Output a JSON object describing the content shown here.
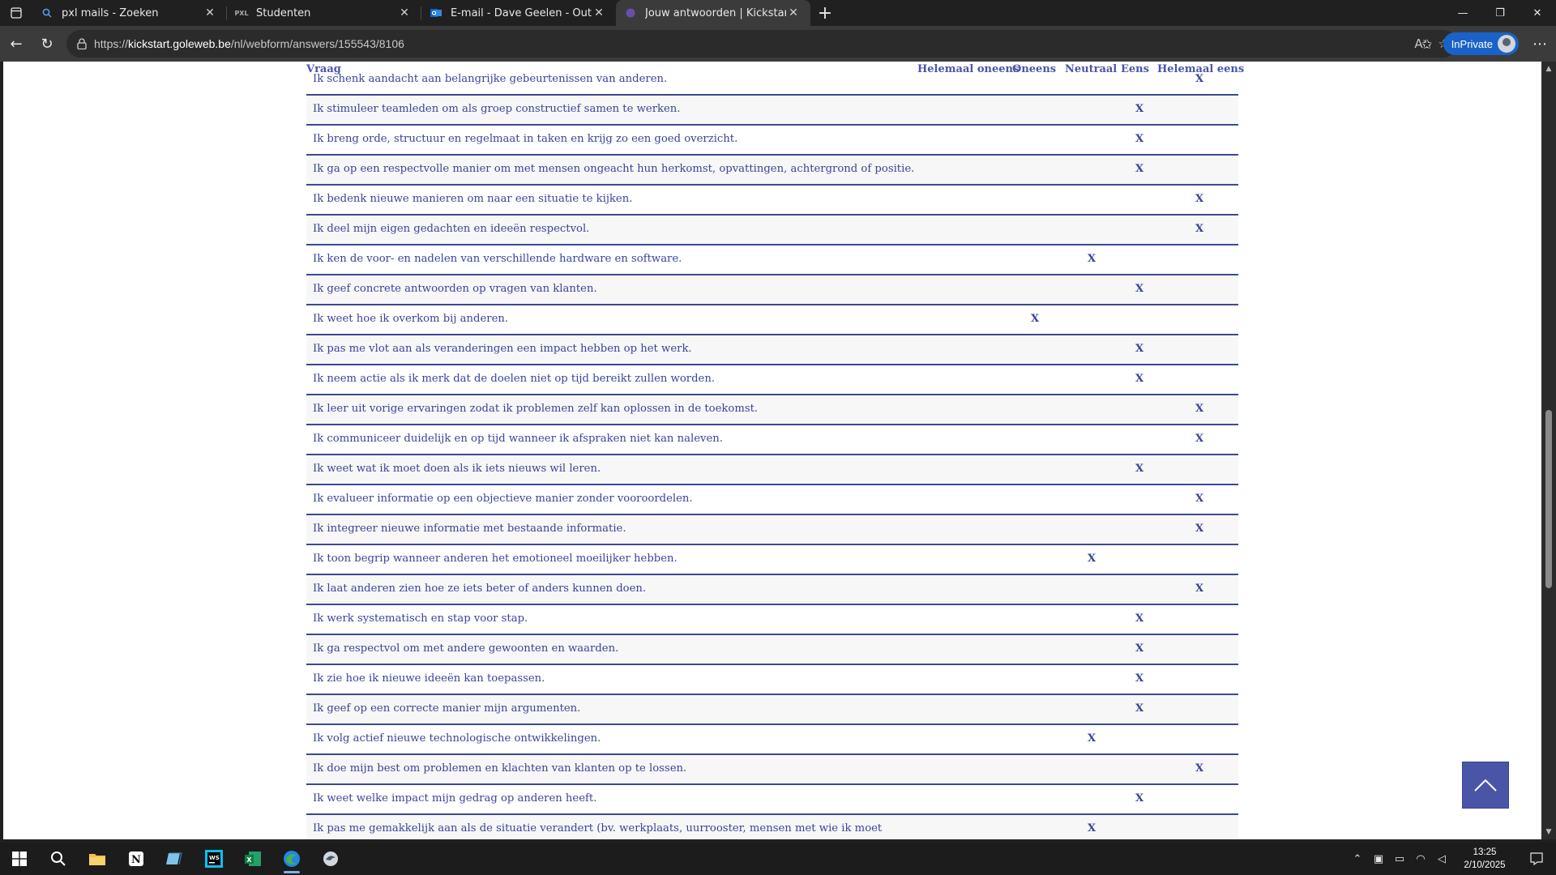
{
  "browser": {
    "tabs": [
      {
        "title": "pxl mails - Zoeken",
        "icon": "search-icon"
      },
      {
        "title": "Studenten",
        "icon": "pxl-icon"
      },
      {
        "title": "E-mail - Dave Geelen - Outlook",
        "icon": "outlook-icon"
      },
      {
        "title": "Jouw antwoorden | Kickstart - Len",
        "icon": "kickstart-icon"
      }
    ],
    "url_prefix": "https://",
    "url_host": "kickstart.goleweb.be",
    "url_path": "/nl/webform/answers/155543/8106",
    "inprivate_label": "InPrivate"
  },
  "table": {
    "headers": {
      "vraag": "Vraag",
      "helemaal_oneens": "Helemaal oneens",
      "oneens": "Oneens",
      "neutraal": "Neutraal",
      "eens": "Eens",
      "helemaal_eens": "Helemaal eens"
    },
    "mark_symbol": "X",
    "rows": [
      {
        "q": "Ik schenk aandacht aan belangrijke gebeurtenissen van anderen.",
        "answer": "helemaal_eens"
      },
      {
        "q": "Ik stimuleer teamleden om als groep constructief samen te werken.",
        "answer": "eens"
      },
      {
        "q": "Ik breng orde, structuur en regelmaat in taken en krijg zo een goed overzicht.",
        "answer": "eens"
      },
      {
        "q": "Ik ga op een respectvolle manier om met mensen ongeacht hun herkomst, opvattingen, achtergrond of positie.",
        "answer": "eens"
      },
      {
        "q": "Ik bedenk nieuwe manieren om naar een situatie te kijken.",
        "answer": "helemaal_eens"
      },
      {
        "q": "Ik deel mijn eigen gedachten en ideeën respectvol.",
        "answer": "helemaal_eens"
      },
      {
        "q": "Ik ken de voor- en nadelen van verschillende hardware en software.",
        "answer": "neutraal"
      },
      {
        "q": "Ik geef concrete antwoorden op vragen van klanten.",
        "answer": "eens"
      },
      {
        "q": "Ik weet hoe ik overkom bij anderen.",
        "answer": "oneens"
      },
      {
        "q": "Ik pas me vlot aan als veranderingen een impact hebben op het werk.",
        "answer": "eens"
      },
      {
        "q": "Ik neem actie als ik merk dat de doelen niet op tijd bereikt zullen worden.",
        "answer": "eens"
      },
      {
        "q": "Ik leer uit vorige ervaringen zodat ik problemen zelf kan oplossen in de toekomst.",
        "answer": "helemaal_eens"
      },
      {
        "q": "Ik communiceer duidelijk en op tijd wanneer ik afspraken niet kan naleven.",
        "answer": "helemaal_eens"
      },
      {
        "q": "Ik weet wat ik moet doen als ik iets nieuws wil leren.",
        "answer": "eens"
      },
      {
        "q": "Ik evalueer informatie op een objectieve manier zonder vooroordelen.",
        "answer": "helemaal_eens"
      },
      {
        "q": "Ik integreer nieuwe informatie met bestaande informatie.",
        "answer": "helemaal_eens"
      },
      {
        "q": "Ik toon begrip wanneer anderen het emotioneel moeilijker hebben.",
        "answer": "neutraal"
      },
      {
        "q": "Ik laat anderen zien hoe ze iets beter of anders kunnen doen.",
        "answer": "helemaal_eens"
      },
      {
        "q": "Ik werk systematisch en stap voor stap.",
        "answer": "eens"
      },
      {
        "q": "Ik ga respectvol om met andere gewoonten en waarden.",
        "answer": "eens"
      },
      {
        "q": "Ik zie hoe ik nieuwe ideeën kan toepassen.",
        "answer": "eens"
      },
      {
        "q": "Ik geef op een correcte manier mijn argumenten.",
        "answer": "eens"
      },
      {
        "q": "Ik volg actief nieuwe technologische ontwikkelingen.",
        "answer": "neutraal"
      },
      {
        "q": "Ik doe mijn best om problemen en klachten van klanten op te lossen.",
        "answer": "helemaal_eens"
      },
      {
        "q": "Ik weet welke impact mijn gedrag op anderen heeft.",
        "answer": "eens"
      },
      {
        "q": "Ik pas me gemakkelijk aan als de situatie verandert (bv. werkplaats, uurrooster, mensen met wie ik moet",
        "answer": "neutraal"
      }
    ]
  },
  "taskbar": {
    "time": "13:25",
    "date": "2/10/2025"
  }
}
